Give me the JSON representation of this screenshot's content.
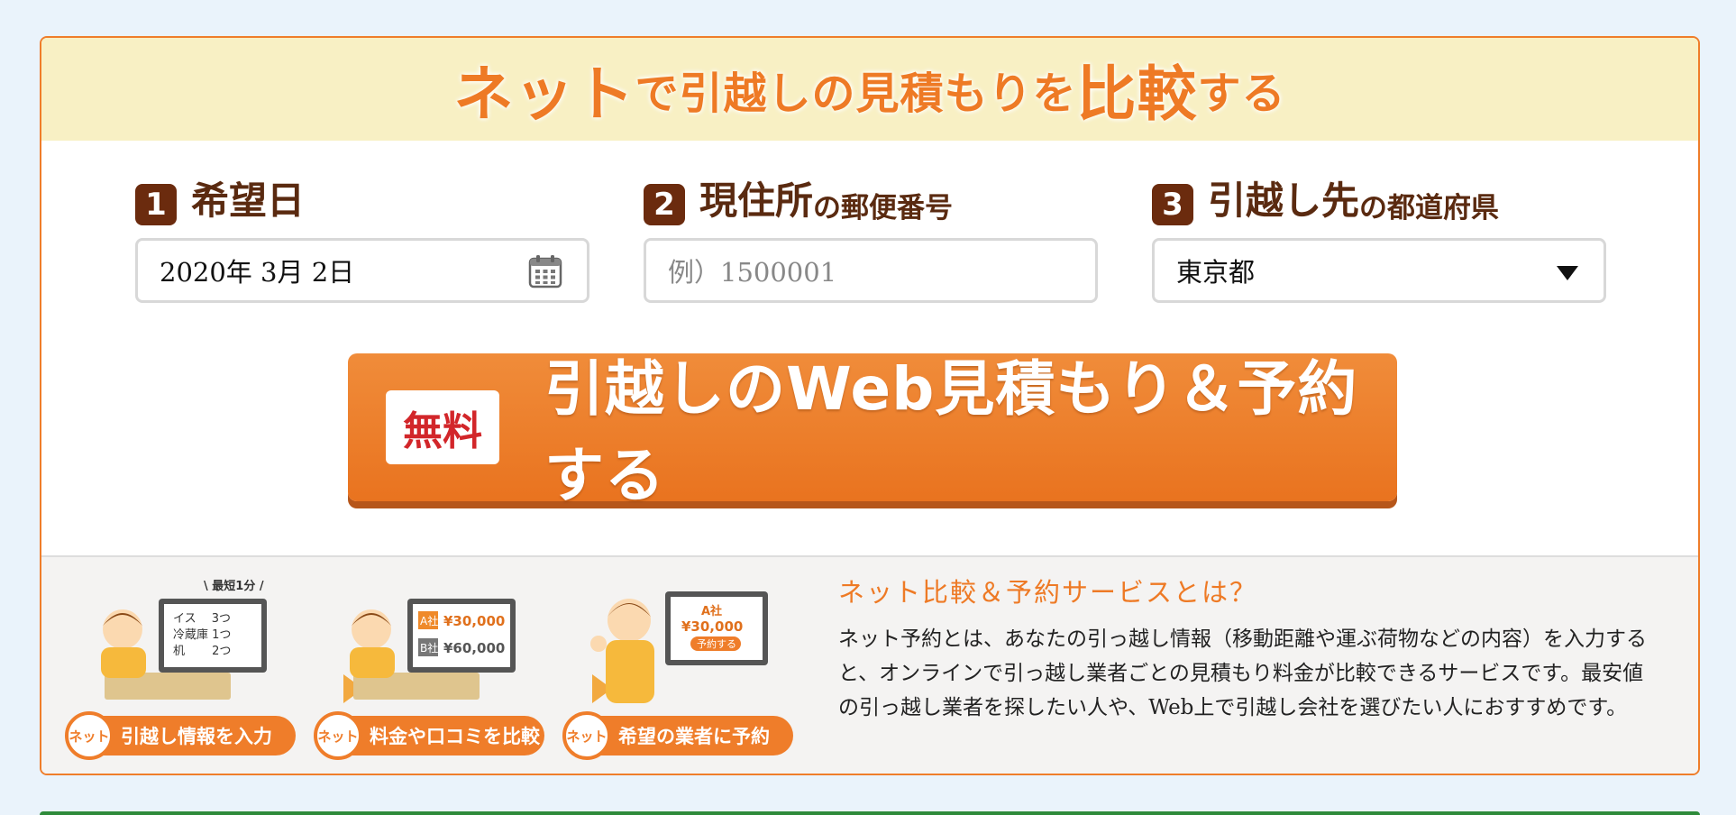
{
  "header": {
    "part1": "ネット",
    "part2": "で",
    "part3": "引越しの見積もりを",
    "part4": "比較",
    "part5": "する"
  },
  "fields": {
    "date": {
      "num": "1",
      "label": "希望日",
      "value": "2020年 3月 2日",
      "icon": "calendar-icon"
    },
    "postal": {
      "num": "2",
      "label_main": "現住所",
      "label_sub": "の郵便番号",
      "placeholder": "例）1500001"
    },
    "prefecture": {
      "num": "3",
      "label_main": "引越し先",
      "label_sub": "の都道府県",
      "value": "東京都"
    }
  },
  "cta": {
    "badge": "無料",
    "label": "引越しのWeb見積もり＆予約する"
  },
  "steps": [
    {
      "badge": "ネット",
      "label": "引越し情報を入力",
      "caption": "最短1分"
    },
    {
      "badge": "ネット",
      "label": "料金や口コミを比較"
    },
    {
      "badge": "ネット",
      "label": "希望の業者に予約"
    }
  ],
  "info": {
    "title": "ネット比較＆予約サービスとは？",
    "body": "ネット予約とは、あなたの引っ越し情報（移動距離や運ぶ荷物などの内容）を入力すると、オンラインで引っ越し業者ごとの見積もり料金が比較できるサービスです。最安値の引っ越し業者を探したい人や、Web上で引越し会社を選びたい人におすすめです。"
  },
  "colors": {
    "accent": "#ee7a25",
    "dark_brown": "#6b2b0e",
    "header_bg": "#f8f0c4",
    "badge_red": "#d2262a"
  }
}
